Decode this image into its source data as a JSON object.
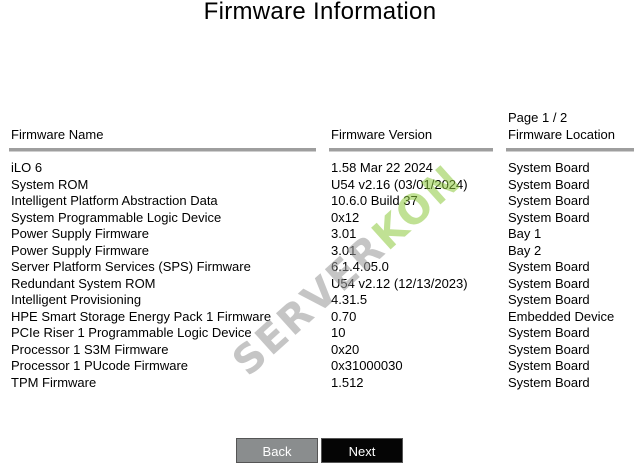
{
  "page": {
    "title": "Firmware Information",
    "page_indicator": "Page 1 / 2"
  },
  "table": {
    "headers": {
      "name": "Firmware Name",
      "version": "Firmware Version",
      "location": "Firmware Location"
    },
    "rows": [
      {
        "name": "iLO 6",
        "version": "1.58 Mar 22 2024",
        "location": "System Board"
      },
      {
        "name": "System ROM",
        "version": "U54 v2.16 (03/01/2024)",
        "location": "System Board"
      },
      {
        "name": "Intelligent Platform Abstraction Data",
        "version": "10.6.0 Build 37",
        "location": "System Board"
      },
      {
        "name": "System Programmable Logic Device",
        "version": "0x12",
        "location": "System Board"
      },
      {
        "name": "Power Supply Firmware",
        "version": "3.01",
        "location": "Bay 1"
      },
      {
        "name": "Power Supply Firmware",
        "version": "3.01",
        "location": "Bay 2"
      },
      {
        "name": "Server Platform Services (SPS) Firmware",
        "version": "6.1.4.05.0",
        "location": "System Board"
      },
      {
        "name": "Redundant System ROM",
        "version": "U54 v2.12 (12/13/2023)",
        "location": "System Board"
      },
      {
        "name": "Intelligent Provisioning",
        "version": "4.31.5",
        "location": "System Board"
      },
      {
        "name": "HPE Smart Storage Energy Pack 1 Firmware",
        "version": "0.70",
        "location": "Embedded Device"
      },
      {
        "name": "PCIe Riser 1 Programmable Logic Device",
        "version": "10",
        "location": "System Board"
      },
      {
        "name": "Processor 1 S3M Firmware",
        "version": "0x20",
        "location": "System Board"
      },
      {
        "name": "Processor 1 PUcode Firmware",
        "version": "0x31000030",
        "location": "System Board"
      },
      {
        "name": "TPM Firmware",
        "version": "1.512",
        "location": "System Board"
      }
    ]
  },
  "buttons": {
    "back": "Back",
    "next": "Next"
  },
  "watermark": {
    "main": "SERVER",
    "accent": "KON"
  },
  "colors": {
    "rule": "#9e9e9e",
    "back_button_bg": "#8a8d8e",
    "next_button_bg": "#050505"
  }
}
